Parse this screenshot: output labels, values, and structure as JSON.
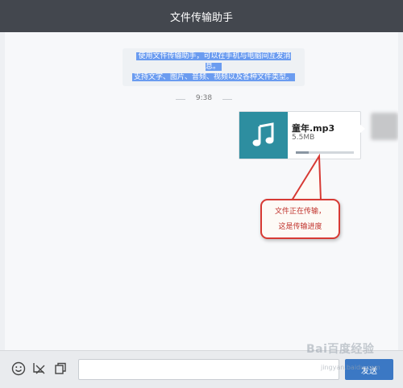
{
  "window": {
    "title": "文件传输助手"
  },
  "notice": {
    "line1": "使用文件传输助手，可以在手机与电脑间互发消息。",
    "line2": "支持文字、图片、音频、视频以及各种文件类型。"
  },
  "timestamp": "9:38",
  "message": {
    "file_name": "童年.mp3",
    "file_size": "5.5MB",
    "file_icon": "music-note-icon",
    "progress": 0.22
  },
  "callout": {
    "line1": "文件正在传输，",
    "line2": "这是传输进度"
  },
  "toolbar": {
    "emoji_icon": "smiley-icon",
    "screenshot_icon": "scissors-icon",
    "file_icon": "copy-icon",
    "send_label": "发送"
  },
  "watermark": {
    "brand": "Bai百度经验",
    "url": "jingyan.baidu.com"
  },
  "colors": {
    "titlebar": "#43474e",
    "accent": "#3b78c4",
    "file_thumb": "#2d8ea0",
    "callout_border": "#d73a34"
  }
}
